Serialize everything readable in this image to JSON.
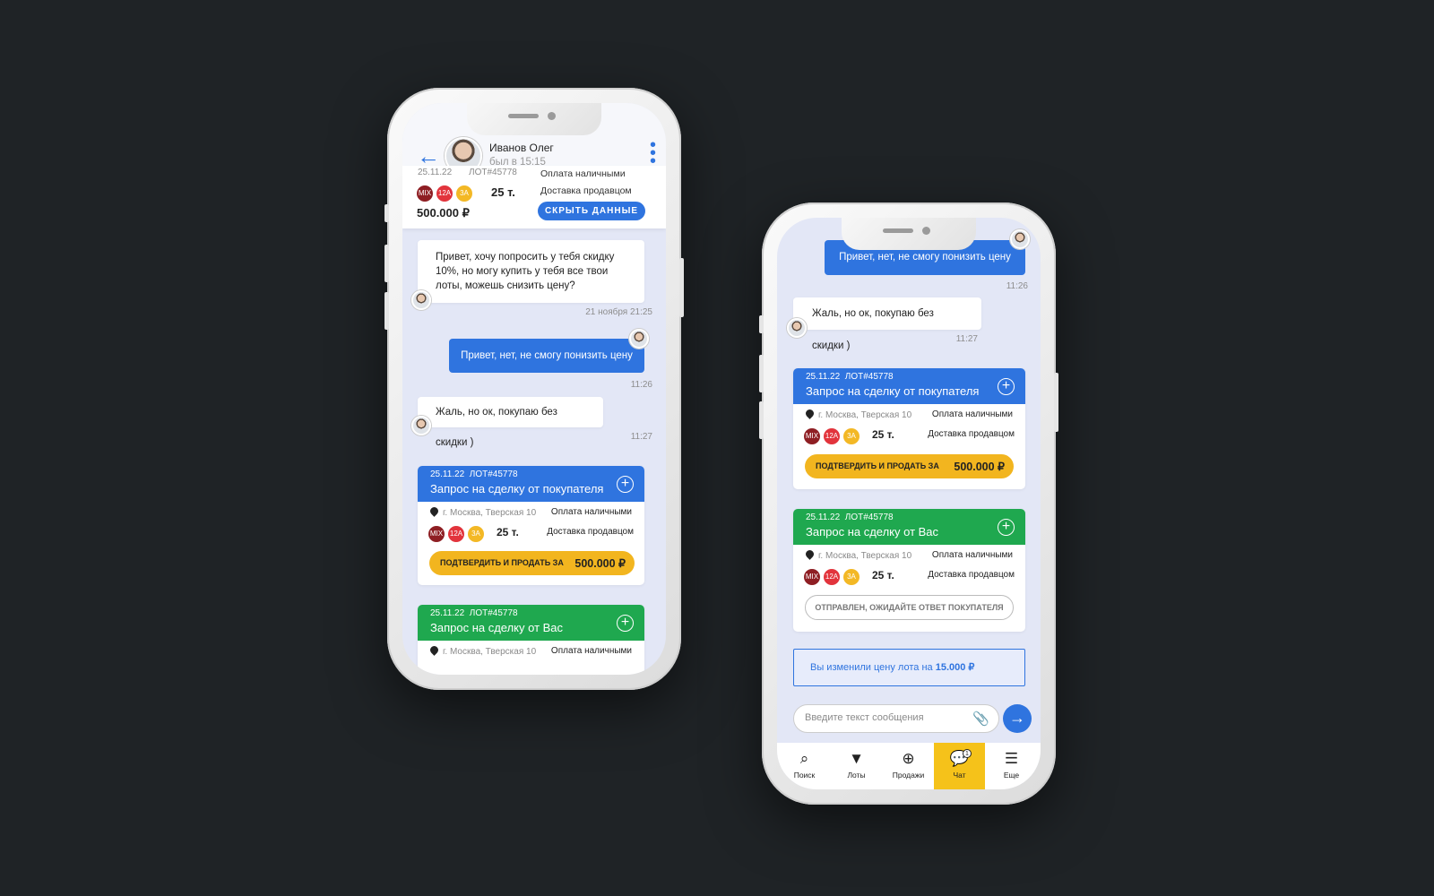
{
  "header": {
    "name": "Иванов Олег",
    "status": "был в 15:15"
  },
  "lot_summary": {
    "date": "25.11.22",
    "lot": "ЛОТ#45778",
    "badges": [
      "MIX",
      "12A",
      "3A"
    ],
    "weight": "25 т.",
    "payment": "Оплата наличными",
    "delivery": "Доставка продавцом",
    "price": "500.000 ₽",
    "hide_button": "СКРЫТЬ ДАННЫЕ"
  },
  "messages": {
    "m1_text": "Привет, хочу попросить у тебя скидку 10%, но могу купить у тебя все твои лоты, можешь снизить цену?",
    "m1_time": "21 ноября 21:25",
    "m2_text": "Привет, нет, не смогу понизить цену",
    "m2_time": "11:26",
    "m3_text": "Жаль, но ок, покупаю без скидки )",
    "m3_time": "11:27"
  },
  "deal_buyer": {
    "date": "25.11.22",
    "lot": "ЛОТ#45778",
    "title": "Запрос на сделку от покупателя",
    "address": "г. Москва, Тверская 10",
    "payment": "Оплата наличными",
    "weight": "25 т.",
    "delivery": "Доставка продавцом",
    "confirm_label": "ПОДТВЕРДИТЬ И ПРОДАТЬ ЗА",
    "price": "500.000 ₽"
  },
  "deal_you": {
    "date": "25.11.22",
    "lot": "ЛОТ#45778",
    "title": "Запрос на сделку от Вас",
    "address": "г. Москва, Тверская 10",
    "payment": "Оплата наличными",
    "weight": "25 т.",
    "delivery": "Доставка продавцом",
    "waiting_label": "ОТПРАВЛЕН, ОЖИДАЙТЕ ОТВЕТ ПОКУПАТЕЛЯ"
  },
  "notice": {
    "text": "Вы изменили цену лота на",
    "amount": "15.000 ₽"
  },
  "composer": {
    "placeholder": "Введите текст сообщения"
  },
  "tabbar": {
    "items": [
      {
        "label": "Поиск",
        "icon": "search-icon"
      },
      {
        "label": "Лоты",
        "icon": "bucket-icon"
      },
      {
        "label": "Продажи",
        "icon": "plus-circle-icon"
      },
      {
        "label": "Чат",
        "icon": "chat-icon",
        "badge": "1"
      },
      {
        "label": "Еще",
        "icon": "menu-icon"
      }
    ]
  },
  "colors": {
    "accent": "#2f74df",
    "green": "#1fa84f",
    "yellow": "#f2b51f",
    "background": "#1f2326"
  }
}
